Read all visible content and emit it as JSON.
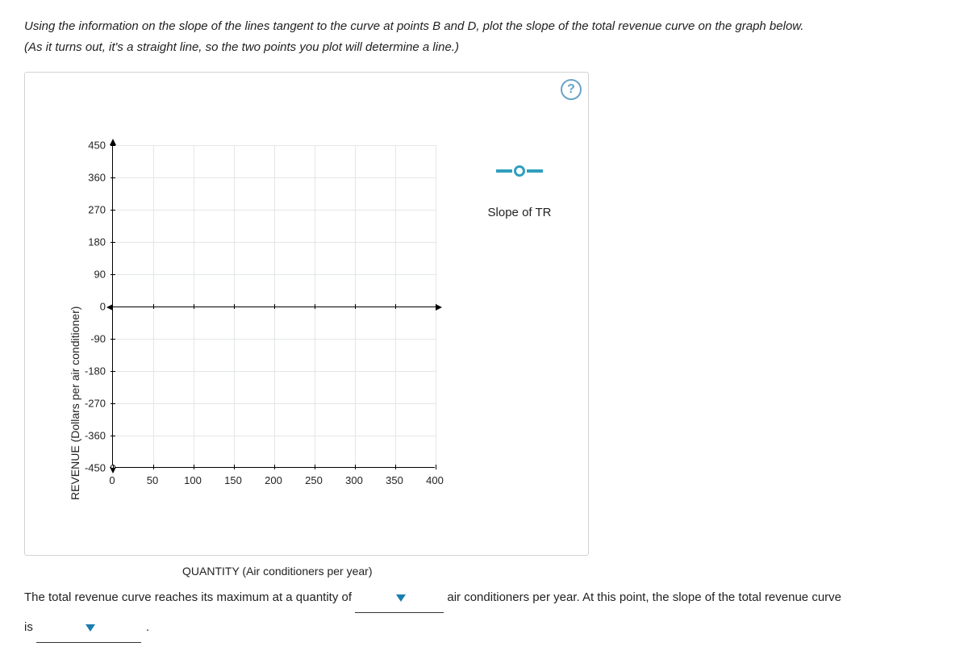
{
  "instructions": {
    "line1": "Using the information on the slope of the lines tangent to the curve at points B and D, plot the slope of the total revenue curve on the graph below.",
    "line2": "(As it turns out, it's a straight line, so the two points you plot will determine a line.)"
  },
  "help_label": "?",
  "legend": {
    "label": "Slope of TR"
  },
  "chart_data": {
    "type": "scatter",
    "title": "",
    "xlabel": "QUANTITY (Air conditioners per year)",
    "ylabel": "REVENUE (Dollars per air conditioner)",
    "xlim": [
      0,
      400
    ],
    "ylim": [
      -450,
      450
    ],
    "x_ticks": [
      0,
      50,
      100,
      150,
      200,
      250,
      300,
      350,
      400
    ],
    "y_ticks": [
      -450,
      -360,
      -270,
      -180,
      -90,
      0,
      90,
      180,
      270,
      360,
      450
    ],
    "series": [
      {
        "name": "Slope of TR",
        "x": [],
        "y": []
      }
    ],
    "grid": true
  },
  "question": {
    "part1_before": "The total revenue curve reaches its maximum at a quantity of",
    "part1_after": "air conditioners per year. At this point, the slope of the total revenue curve",
    "part2_before": "is",
    "part2_after": "."
  }
}
